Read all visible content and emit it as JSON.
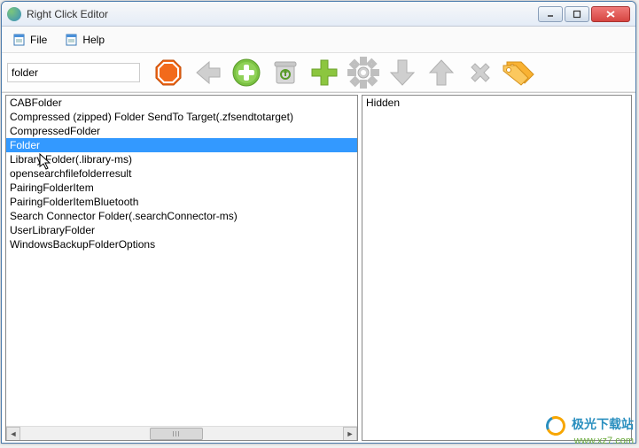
{
  "window": {
    "title": "Right Click Editor"
  },
  "menu": {
    "file": "File",
    "help": "Help"
  },
  "search": {
    "value": "folder",
    "placeholder": ""
  },
  "left_items": [
    {
      "label": "CABFolder",
      "selected": false
    },
    {
      "label": "Compressed (zipped) Folder SendTo Target(.zfsendtotarget)",
      "selected": false
    },
    {
      "label": "CompressedFolder",
      "selected": false
    },
    {
      "label": "Folder",
      "selected": true
    },
    {
      "label": "Library Folder(.library-ms)",
      "selected": false
    },
    {
      "label": "opensearchfilefolderresult",
      "selected": false
    },
    {
      "label": "PairingFolderItem",
      "selected": false
    },
    {
      "label": "PairingFolderItemBluetooth",
      "selected": false
    },
    {
      "label": "Search Connector Folder(.searchConnector-ms)",
      "selected": false
    },
    {
      "label": "UserLibraryFolder",
      "selected": false
    },
    {
      "label": "WindowsBackupFolderOptions",
      "selected": false
    }
  ],
  "right_items": [
    {
      "label": "Hidden"
    }
  ],
  "toolbar_icons": {
    "stop": "stop-icon",
    "back": "arrow-left-icon",
    "add_round": "add-circle-icon",
    "trash": "trash-icon",
    "add_plus": "plus-icon",
    "settings": "gear-icon",
    "down": "arrow-down-icon",
    "up": "arrow-up-icon",
    "delete": "x-icon",
    "tag": "tag-icon"
  },
  "watermark": {
    "brand": "极光下载站",
    "url": "www.xz7.com"
  }
}
